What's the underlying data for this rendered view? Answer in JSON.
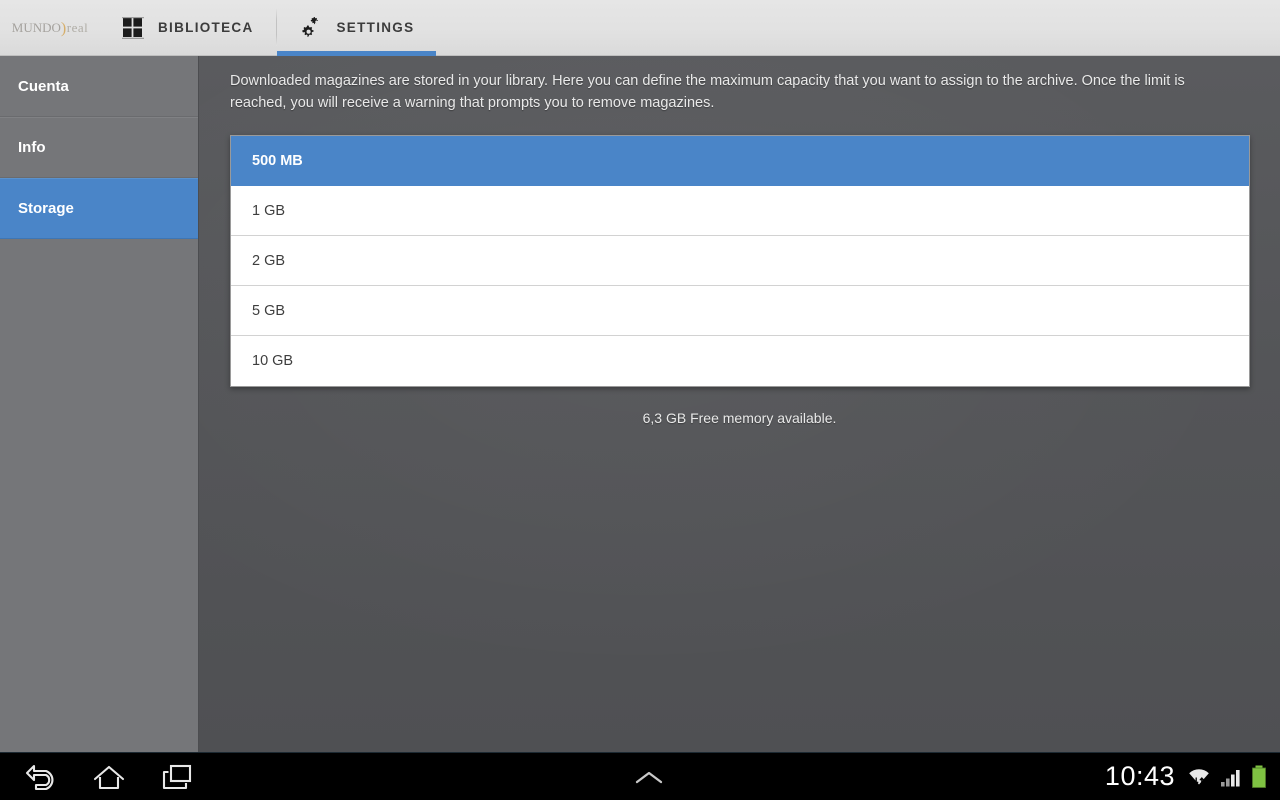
{
  "app": {
    "logo_part1": "MUNDO",
    "logo_separator": ")",
    "logo_part2": "real"
  },
  "action_bar": {
    "tabs": [
      {
        "label": "BIBLIOTECA",
        "icon": "grid-icon",
        "active": false
      },
      {
        "label": "SETTINGS",
        "icon": "gears-icon",
        "active": true
      }
    ]
  },
  "sidebar": {
    "items": [
      {
        "label": "Cuenta",
        "selected": false
      },
      {
        "label": "Info",
        "selected": false
      },
      {
        "label": "Storage",
        "selected": true
      }
    ]
  },
  "main": {
    "description": "Downloaded magazines are stored in your library. Here you can define the maximum capacity that you want to assign to the archive. Once the limit is reached, you will receive a warning that prompts you to remove magazines.",
    "options": [
      {
        "label": "500 MB",
        "selected": true
      },
      {
        "label": "1 GB",
        "selected": false
      },
      {
        "label": "2 GB",
        "selected": false
      },
      {
        "label": "5 GB",
        "selected": false
      },
      {
        "label": "10 GB",
        "selected": false
      }
    ],
    "free_memory": "6,3 GB Free memory available."
  },
  "system_bar": {
    "back_icon": "back-arrow-icon",
    "home_icon": "home-icon",
    "recents_icon": "recent-apps-icon",
    "expand_icon": "chevron-up-icon",
    "clock": "10:43",
    "wifi_icon": "wifi-icon",
    "signal_icon": "cellular-signal-icon",
    "battery_icon": "battery-full-icon"
  },
  "colors": {
    "accent_blue": "#4a85c8",
    "sidebar_gray": "#757679",
    "content_gray": "#545558",
    "action_bar_gray": "#e1e1e1",
    "battery_green": "#7fc242"
  }
}
